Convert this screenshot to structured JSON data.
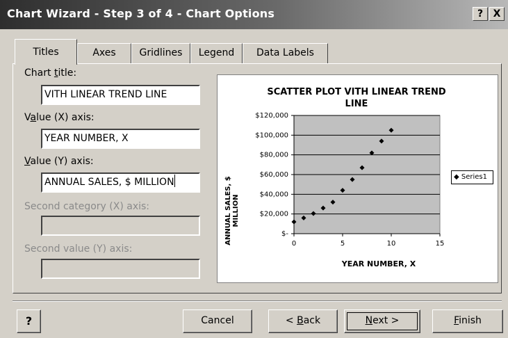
{
  "window": {
    "title": "Chart Wizard - Step 3 of 4 - Chart Options",
    "help_glyph": "?",
    "close_glyph": "X"
  },
  "tabs": [
    {
      "label": "Titles",
      "active": true
    },
    {
      "label": "Axes",
      "active": false
    },
    {
      "label": "Gridlines",
      "active": false
    },
    {
      "label": "Legend",
      "active": false
    },
    {
      "label": "Data Labels",
      "active": false
    }
  ],
  "form": {
    "chart_title": {
      "label_pre": "Chart ",
      "label_key": "t",
      "label_post": "itle:",
      "value": "VITH LINEAR TREND LINE"
    },
    "value_x": {
      "label_pre": "V",
      "label_key": "a",
      "label_post": "lue (X) axis:",
      "value": "YEAR NUMBER, X"
    },
    "value_y": {
      "label_pre": "",
      "label_key": "V",
      "label_post": "alue (Y) axis:",
      "value": "ANNUAL SALES, $ MILLION"
    },
    "second_category": {
      "label": "Second category (X) axis:",
      "value": ""
    },
    "second_value": {
      "label": "Second value (Y) axis:",
      "value": ""
    }
  },
  "chart_data": {
    "type": "scatter",
    "title": "SCATTER PLOT VITH LINEAR TREND LINE",
    "title_line1": "SCATTER PLOT VITH LINEAR TREND",
    "title_line2": "LINE",
    "xlabel": "YEAR NUMBER, X",
    "ylabel": "ANNUAL SALES, $ MILLION",
    "ylabel_line1": "ANNUAL SALES, $",
    "ylabel_line2": "MILLION",
    "xlim": [
      0,
      15
    ],
    "ylim": [
      0,
      120000
    ],
    "x_ticks": [
      "0",
      "5",
      "10",
      "15"
    ],
    "y_ticks": [
      "$-",
      "$20,000",
      "$40,000",
      "$60,000",
      "$80,000",
      "$100,000",
      "$120,000"
    ],
    "grid": true,
    "plot_background": "#c0c0c0",
    "legend_position": "right",
    "series": [
      {
        "name": "Series1",
        "marker": "diamond",
        "x": [
          0,
          1,
          2,
          3,
          4,
          5,
          6,
          7,
          8,
          9,
          10
        ],
        "y": [
          12000,
          16000,
          20500,
          26000,
          32000,
          44000,
          55000,
          67000,
          82000,
          94000,
          105000
        ]
      }
    ]
  },
  "buttons": {
    "help": "?",
    "cancel": "Cancel",
    "back_pre": "< ",
    "back_key": "B",
    "back_post": "ack",
    "next_key": "N",
    "next_post": "ext >",
    "finish_key": "F",
    "finish_post": "inish"
  }
}
